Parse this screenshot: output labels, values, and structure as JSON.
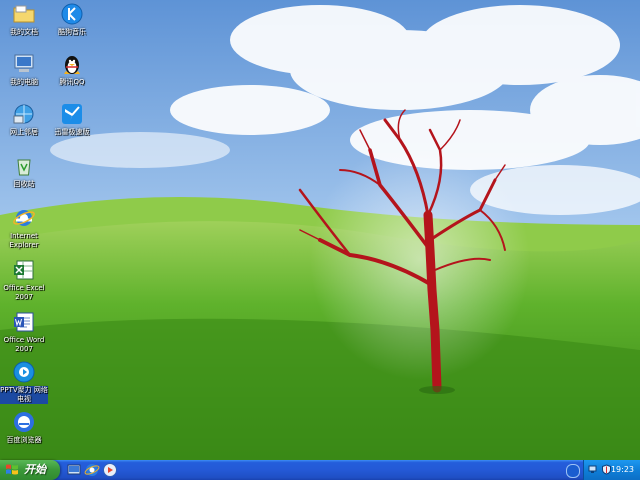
{
  "desktop": {
    "icons": [
      {
        "label": "我的文档",
        "icon": "folder-icon"
      },
      {
        "label": "酷狗音乐",
        "icon": "kugou-icon"
      },
      {
        "label": "我的电脑",
        "icon": "computer-icon"
      },
      {
        "label": "腾讯QQ",
        "icon": "qq-penguin-icon"
      },
      {
        "label": "网上邻居",
        "icon": "network-icon"
      },
      {
        "label": "迅雷极速版",
        "icon": "thunder-bird-icon"
      },
      {
        "label": "回收站",
        "icon": "recycle-bin-icon"
      },
      {
        "label": "Internet Explorer",
        "icon": "ie-icon"
      },
      {
        "label": "Office Excel 2007",
        "icon": "excel-icon"
      },
      {
        "label": "Office Word 2007",
        "icon": "word-icon"
      },
      {
        "label": "PPTV聚力 网络电视",
        "icon": "pptv-icon"
      },
      {
        "label": "百度浏览器",
        "icon": "baidu-browser-icon"
      }
    ]
  },
  "taskbar": {
    "start_label": "开始",
    "quick_launch": [
      "show-desktop-icon",
      "ie-icon",
      "media-player-icon"
    ],
    "tray": {
      "clock": "19:23",
      "icons": [
        "network-status-icon",
        "security-shield-icon"
      ]
    }
  },
  "colors": {
    "taskbar_blue": "#245edb",
    "start_green": "#3c9a3a",
    "tray_blue": "#0f7fd8",
    "tree_red": "#b4141c"
  }
}
